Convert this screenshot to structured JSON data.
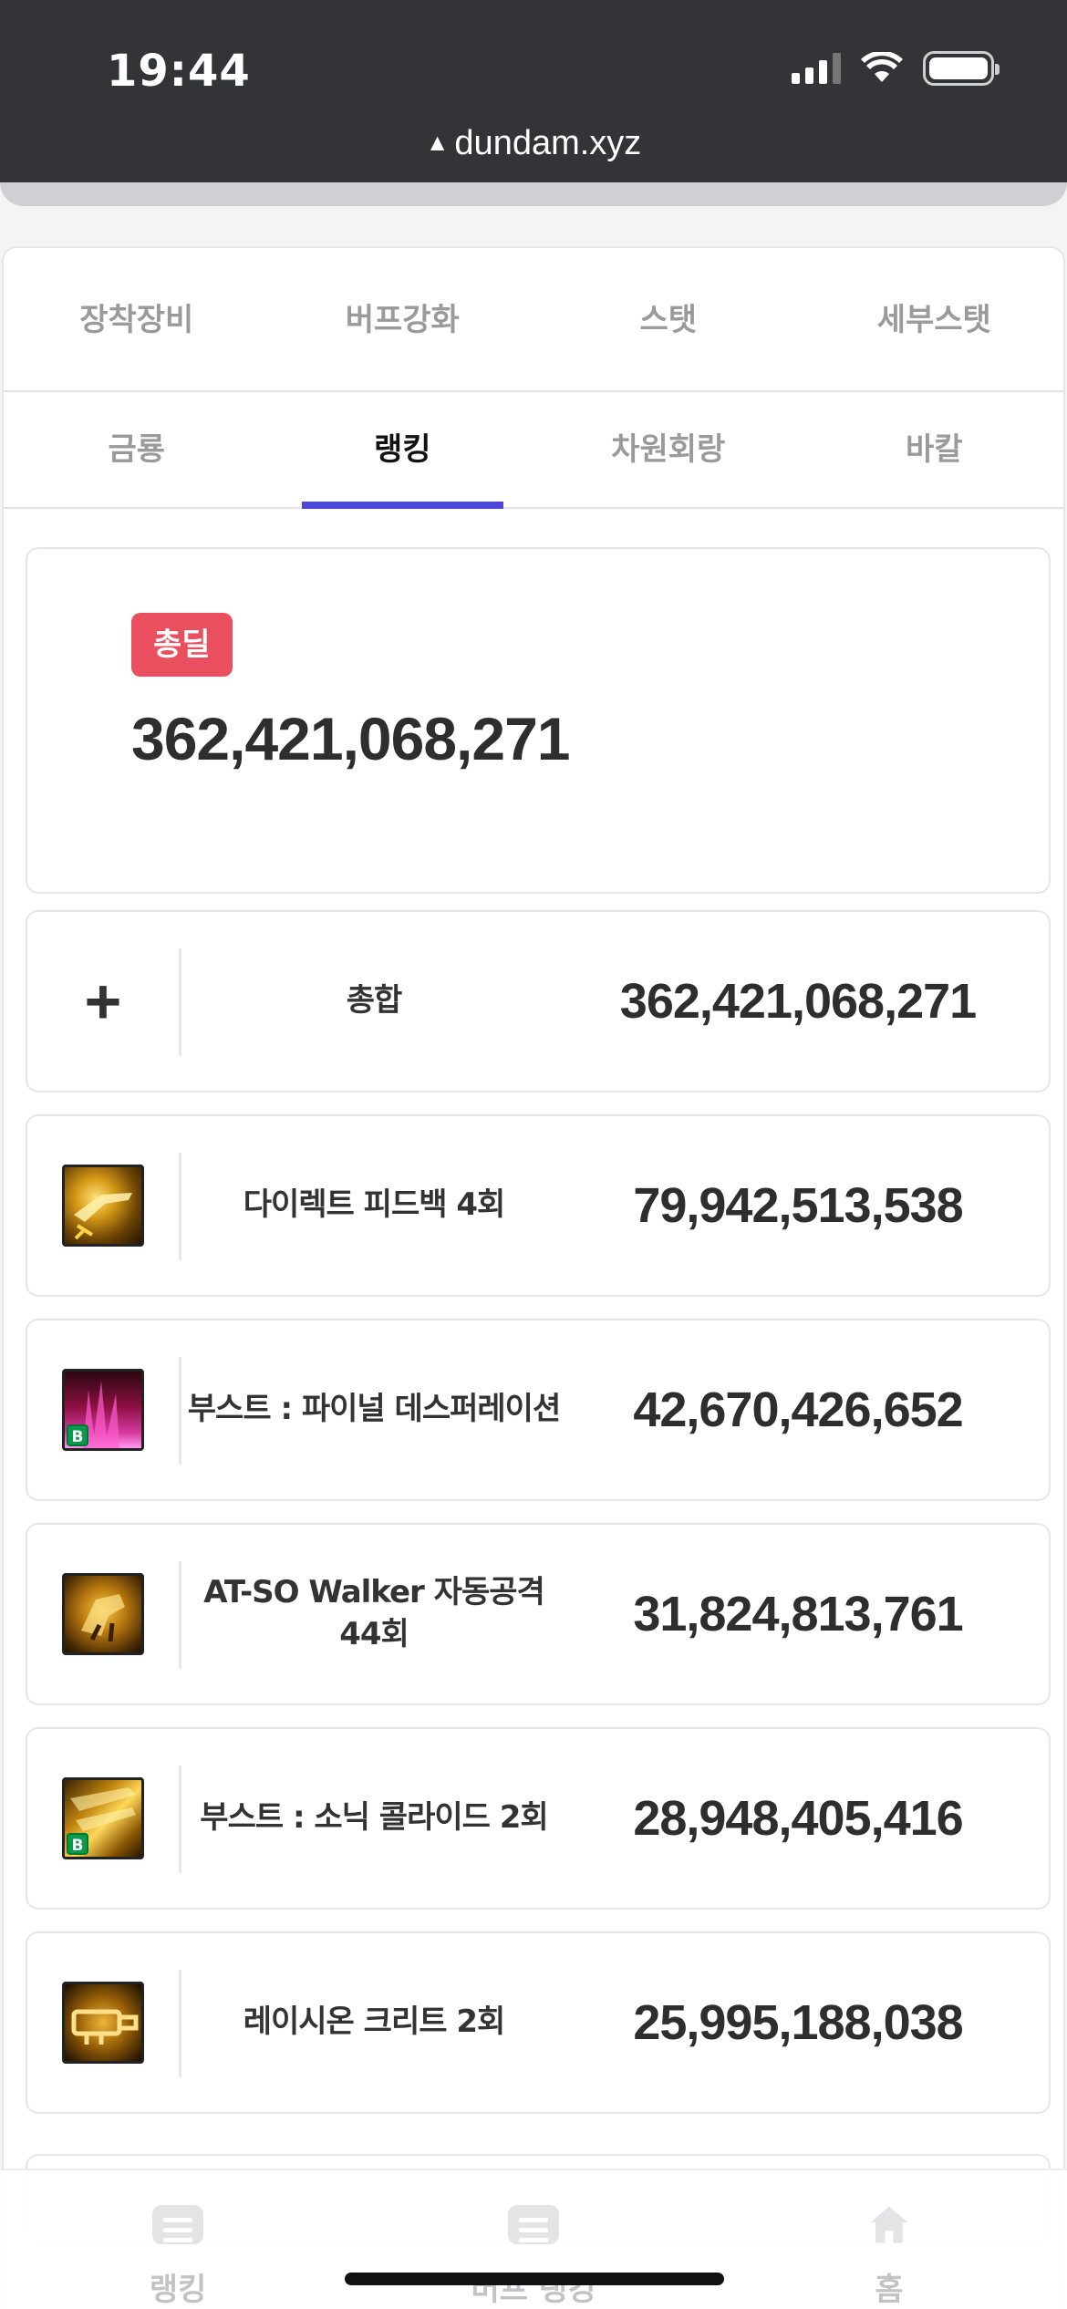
{
  "status_bar": {
    "time": "19:44"
  },
  "browser": {
    "url": "dundam.xyz"
  },
  "tabs_primary": [
    {
      "label": "장착장비"
    },
    {
      "label": "버프강화"
    },
    {
      "label": "스탯"
    },
    {
      "label": "세부스탯"
    }
  ],
  "tabs_secondary": [
    {
      "label": "금룡",
      "active": false
    },
    {
      "label": "랭킹",
      "active": true
    },
    {
      "label": "차원회랑",
      "active": false
    },
    {
      "label": "바칼",
      "active": false
    }
  ],
  "summary": {
    "badge": "총딜",
    "total": "362,421,068,271",
    "badge_color": "#ea4f5f"
  },
  "damage_rows": [
    {
      "icon": "plus-icon",
      "name": "총합",
      "value": "362,421,068,271"
    },
    {
      "icon": "direct-feedback-skill-icon",
      "name": "다이렉트 피드백 4회",
      "value": "79,942,513,538"
    },
    {
      "icon": "boost-final-desperation-skill-icon",
      "name": "부스트 : 파이널 데스퍼레이션",
      "value": "42,670,426,652"
    },
    {
      "icon": "at-so-walker-skill-icon",
      "name": "AT-SO Walker 자동공격 44회",
      "value": "31,824,813,761"
    },
    {
      "icon": "boost-sonic-collide-skill-icon",
      "name": "부스트 : 소닉 콜라이드 2회",
      "value": "28,948,405,416"
    },
    {
      "icon": "lacion-crit-skill-icon",
      "name": "레이시온 크리트 2회",
      "value": "25,995,188,038"
    }
  ],
  "bottom_nav": [
    {
      "label": "랭킹",
      "icon": "list-icon"
    },
    {
      "label": "버프 랭킹",
      "icon": "list-icon"
    },
    {
      "label": "홈",
      "icon": "home-icon"
    }
  ],
  "colors": {
    "accent": "#4c46d9",
    "badge": "#ea4f5f",
    "header": "#323437"
  }
}
